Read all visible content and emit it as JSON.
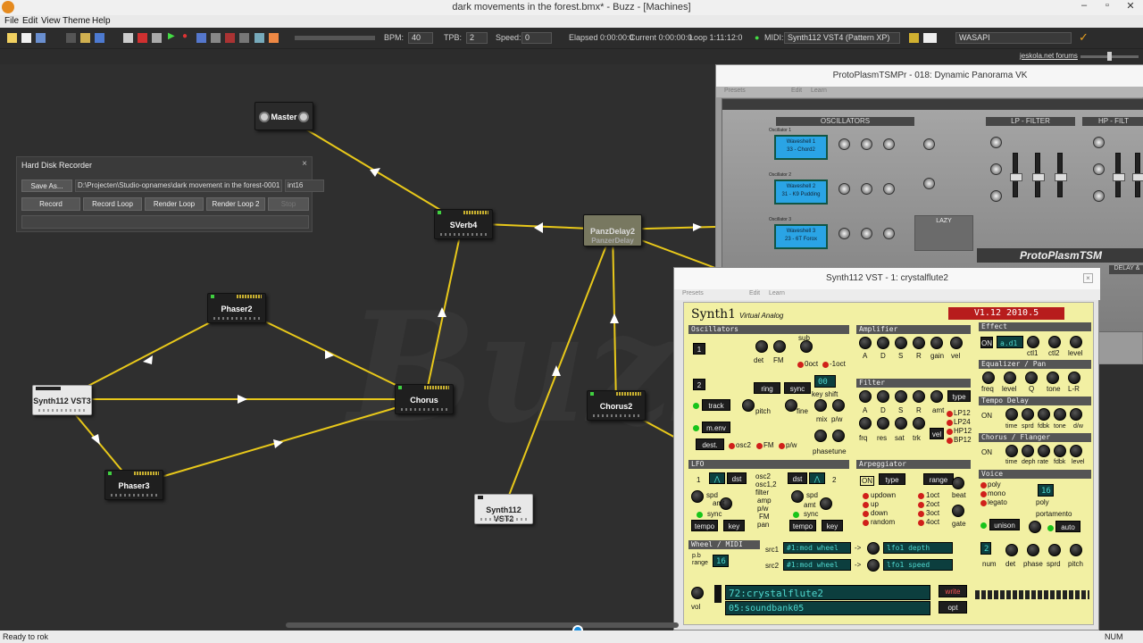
{
  "window": {
    "title": "dark movements in the forest.bmx* - Buzz - [Machines]"
  },
  "menu": {
    "items": [
      "File",
      "Edit",
      "View",
      "Theme",
      "Help"
    ]
  },
  "toolbar": {
    "bpm_label": "BPM:",
    "bpm_value": "40",
    "tpb_label": "TPB:",
    "tpb_value": "2",
    "speed_label": "Speed:",
    "speed_value": "0",
    "elapsed": "Elapsed 0:00:00:0",
    "current": "Current 0:00:00:0",
    "loop": "Loop 1:11:12:0",
    "midi_label": "MIDI:",
    "midi_value": "Synth112 VST4 (Pattern XP)",
    "audio_driver": "WASAPI"
  },
  "toolbar2": {
    "forums_link": "jeskola.net forums"
  },
  "machine_view": {
    "watermark": "Buzz"
  },
  "machines": {
    "master": "Master",
    "sverb4": "SVerb4",
    "panzdelay2": "PanzDelay2",
    "panzdelay2_sub": "PanzerDelay",
    "phaser2": "Phaser2",
    "chorus": "Chorus",
    "chorus2": "Chorus2",
    "phaser3": "Phaser3",
    "synth_vst3": "Synth112 VST3",
    "synth_vst2": "Synth112 VST2",
    "synth_vst3_tag": "MIDI A"
  },
  "hdr": {
    "title": "Hard Disk Recorder",
    "close": "×",
    "save_as": "Save As...",
    "path": "D:\\Projecten\\Studio-opnames\\dark movement in the forest-0001",
    "format": "int16",
    "record": "Record",
    "record_loop": "Record Loop",
    "render_loop": "Render Loop",
    "render_loop2": "Render Loop 2",
    "stop": "Stop"
  },
  "protoplasm": {
    "title": "ProtoPlasmTSMPr - 018: Dynamic Panorama VK",
    "menu_presets": "Presets",
    "menu_edit": "Edit",
    "menu_learn": "Learn",
    "sections": [
      "OSCILLATORS",
      "LP - FILTER",
      "HP - FILT"
    ],
    "osc": [
      {
        "label": "Oscillator 1",
        "wave": "Waveshell 1",
        "name": "33 - Chord2"
      },
      {
        "label": "Oscillator 2",
        "wave": "Waveshell 2",
        "name": "31 - K9 Pudding"
      },
      {
        "label": "Oscillator 3",
        "wave": "Waveshell 3",
        "name": "23 - 6T Forox"
      }
    ],
    "lazy": "LAZY",
    "logo": "ProtoPlasmTSM",
    "delay": "DELAY &"
  },
  "synth1": {
    "title": "Synth112 VST - 1: crystalflute2",
    "menu_presets": "Presets",
    "menu_edit": "Edit",
    "menu_learn": "Learn",
    "logo": "Synth1",
    "logo_sub": "Virtual Analog",
    "version": "V1.12 2010.5",
    "heads": {
      "osc": "Oscillators",
      "amp": "Amplifier",
      "effect": "Effect",
      "eq": "Equalizer / Pan",
      "filter": "Filter",
      "delay": "Tempo Delay",
      "chorus": "Chorus / Flanger",
      "lfo": "LFO",
      "arp": "Arpeggiator",
      "voice": "Voice",
      "wheel": "Wheel / MIDI"
    },
    "osc_labels": {
      "det": "det",
      "fm": "FM",
      "sub": "sub",
      "oct0": "0oct",
      "octm1": "-1oct",
      "ring": "ring",
      "sync": "sync",
      "track": "track",
      "keyshift": "key shift",
      "pitch": "pitch",
      "fine": "fine",
      "menv": "m.env",
      "dest": "dest.",
      "osc2": "osc2",
      "fm2": "FM",
      "pw": "p/w",
      "mix": "mix",
      "pw2": "p/w",
      "phase": "phase",
      "tune": "tune",
      "amt": "amt",
      "a": "A",
      "d": "D",
      "s": "S",
      "r": "R"
    },
    "amp_labels": [
      "A",
      "D",
      "S",
      "R",
      "gain",
      "vel"
    ],
    "effect_on": "ON",
    "effect_type": "a.d1",
    "effect_labels": [
      "ctl1",
      "ctl2",
      "level"
    ],
    "eq_labels": [
      "freq",
      "level",
      "Q",
      "tone",
      "L-R"
    ],
    "filter_labels": [
      "A",
      "D",
      "S",
      "R",
      "amt",
      "type"
    ],
    "filter_knobs": [
      "frq",
      "res",
      "sat",
      "trk",
      "vel"
    ],
    "filter_types": [
      "LP12",
      "LP24",
      "HP12",
      "BP12"
    ],
    "delay_on": "ON",
    "delay_labels": [
      "time",
      "sprd",
      "fdbk",
      "tone",
      "d/w"
    ],
    "chorus_on": "ON",
    "chorus_labels": [
      "time",
      "deph",
      "rate",
      "fdbk",
      "level"
    ],
    "lfo_labels": {
      "one": "1",
      "two": "2",
      "dst": "dst",
      "spd": "spd",
      "amt": "amt",
      "sync": "sync",
      "tempo": "tempo",
      "key": "key",
      "dests": [
        "osc2",
        "osc1,2",
        "filter",
        "amp",
        "p/w",
        "FM",
        "pan"
      ]
    },
    "arp": {
      "on": "ON",
      "type": "type",
      "range": "range",
      "modes": [
        "updown",
        "up",
        "down",
        "random"
      ],
      "octs": [
        "1oct",
        "2oct",
        "3oct",
        "4oct"
      ],
      "beat": "beat",
      "gate": "gate"
    },
    "voice": {
      "modes": [
        "poly",
        "mono",
        "legato"
      ],
      "poly_value": "16",
      "poly_label": "poly",
      "unison": "unison",
      "portamento": "portamento",
      "auto": "auto",
      "num_value": "2",
      "num": "num",
      "det": "det",
      "phase": "phase",
      "sprd": "sprd",
      "pitch": "pitch"
    },
    "wheel": {
      "pb_range_label": "p.b range",
      "pb_range": "16",
      "src1": "src1",
      "src1_val": "#1:mod wheel",
      "dst1_val": "lfo1 depth",
      "src2": "src2",
      "src2_val": "#1:mod wheel",
      "dst2_val": "lfo1 speed"
    },
    "vol": "vol",
    "patch": "72:crystalflute2",
    "bank": "05:soundbank05",
    "write": "write",
    "opt": "opt",
    "osc_row1_num": "1",
    "osc_row2_num": "2",
    "keyshift_value": "00"
  },
  "status": {
    "left": "Ready to rok",
    "right": "NUM"
  },
  "colors": {
    "wire": "#e8c81a",
    "synth_bg": "#f2f0a3",
    "lcd": "#0c3e3e",
    "lcd_text": "#4fd7ce"
  }
}
